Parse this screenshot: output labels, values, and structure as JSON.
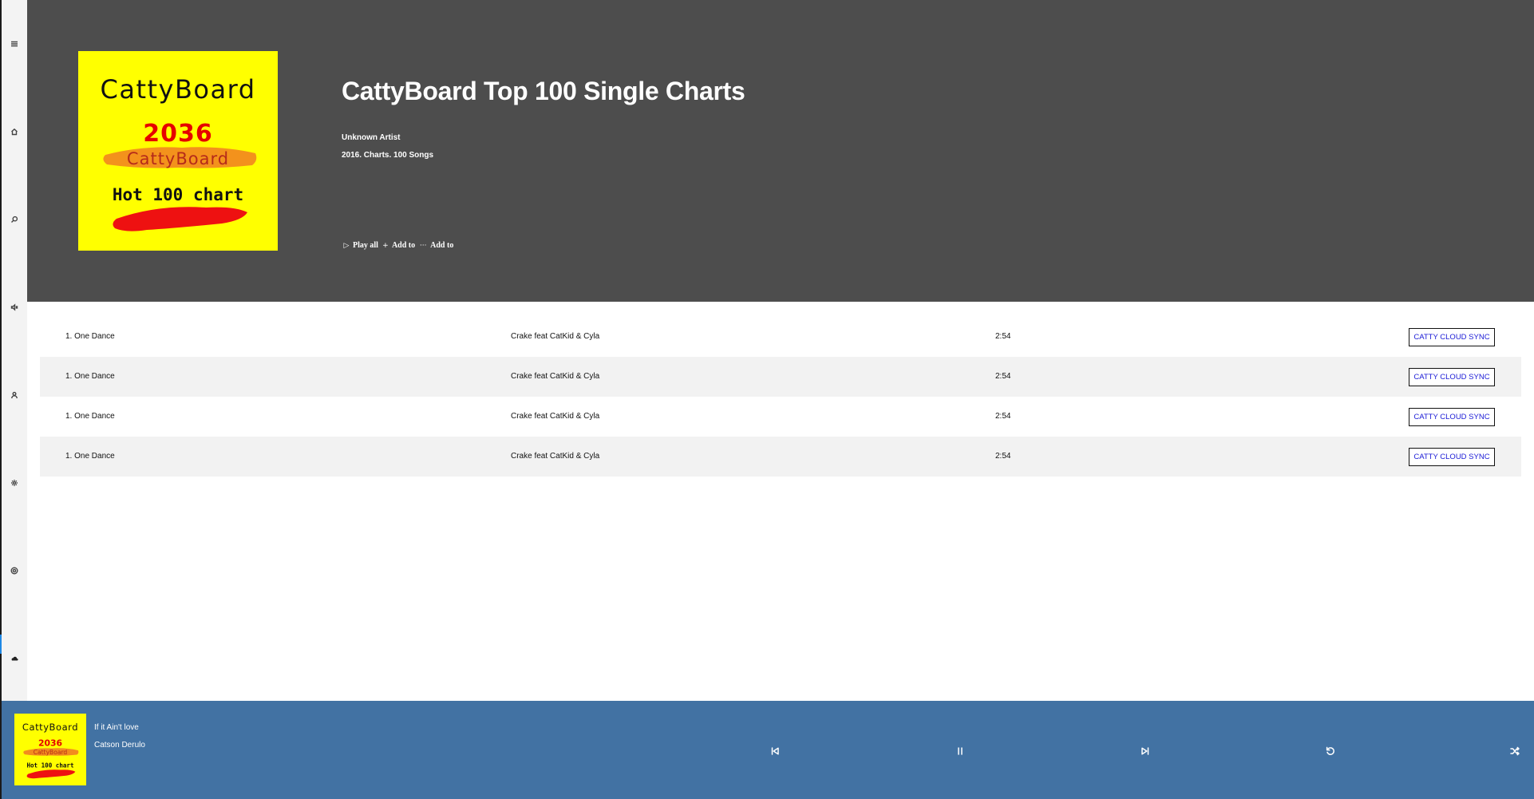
{
  "sidebar": {
    "items": [
      {
        "icon": "hamburger-icon"
      },
      {
        "icon": "home-icon"
      },
      {
        "icon": "search-icon"
      },
      {
        "icon": "speaker-icon"
      },
      {
        "icon": "person-icon"
      },
      {
        "icon": "gear-icon"
      },
      {
        "icon": "globe-icon"
      },
      {
        "icon": "cloud-icon"
      }
    ]
  },
  "album": {
    "cover": {
      "brand": "CattyBoard",
      "year": "2036",
      "subbrand": "CattyBoard",
      "chart": "Hot 100 chart",
      "colors": {
        "background": "#ffff00",
        "year": "#e60000",
        "stroke_orange": "#f28c1e",
        "stroke_red": "#ee1111"
      }
    },
    "title": "CattyBoard Top 100 Single Charts",
    "artist": "Unknown Artist",
    "meta": "2016. Charts. 100 Songs",
    "actions": [
      {
        "glyph": "▷",
        "icon": "play-icon",
        "label": "Play all"
      },
      {
        "glyph": "+",
        "icon": "plus-icon",
        "label": "Add to"
      },
      {
        "glyph": "···",
        "icon": "more-icon",
        "label": "Add to"
      }
    ]
  },
  "songs": [
    {
      "title": "1. One Dance",
      "artist": "Crake feat CatKid & Cyla",
      "duration": "2:54",
      "action": "CATTY CLOUD SYNC"
    },
    {
      "title": "1. One Dance",
      "artist": "Crake feat CatKid & Cyla",
      "duration": "2:54",
      "action": "CATTY CLOUD SYNC"
    },
    {
      "title": "1. One Dance",
      "artist": "Crake feat CatKid & Cyla",
      "duration": "2:54",
      "action": "CATTY CLOUD SYNC"
    },
    {
      "title": "1. One Dance",
      "artist": "Crake feat CatKid & Cyla",
      "duration": "2:54",
      "action": "CATTY CLOUD SYNC"
    }
  ],
  "player": {
    "now_playing": {
      "title": "If it Ain't love",
      "artist": "Catson Derulo"
    },
    "controls": [
      "previous-icon",
      "pause-icon",
      "next-icon",
      "repeat-icon",
      "shuffle-icon"
    ]
  },
  "colors": {
    "header_bg": "#4d4d4d",
    "player_bg": "#4272a3",
    "row_alt_bg": "#f2f2f2",
    "sync_text": "#1a1ad6"
  }
}
